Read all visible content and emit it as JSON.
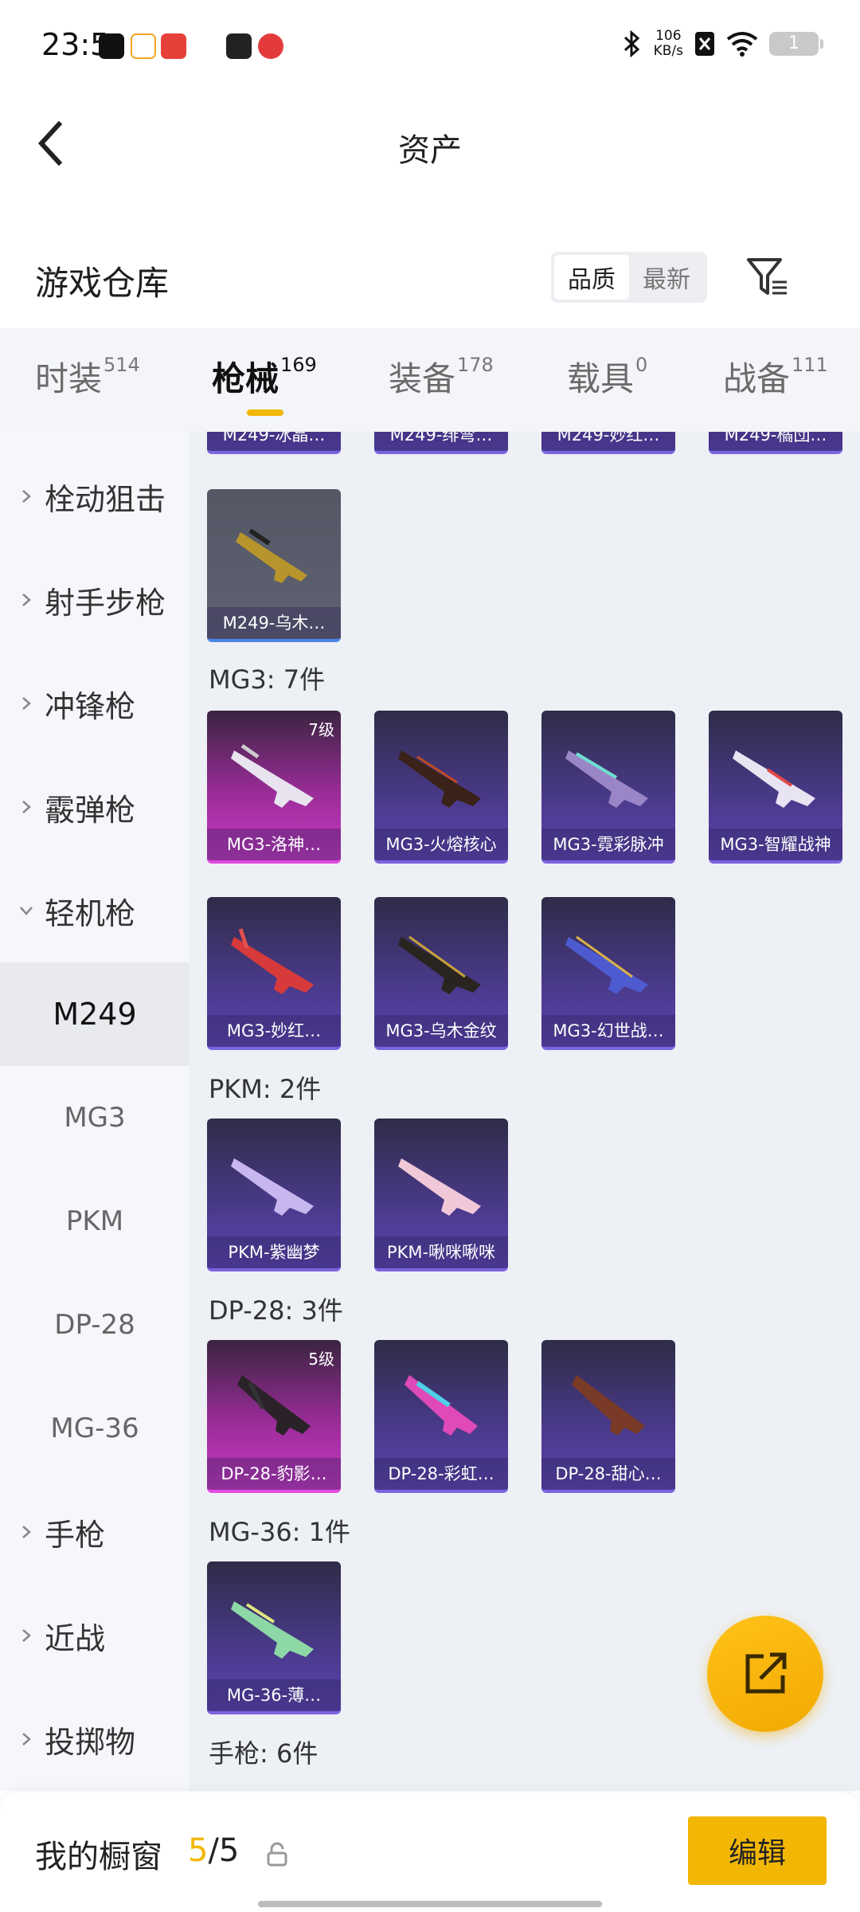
{
  "status_bar": {
    "time": "23:5",
    "net_speed_value": "106",
    "net_speed_unit": "KB/s",
    "battery": "1"
  },
  "header": {
    "title": "资产"
  },
  "warehouse": {
    "title": "游戏仓库",
    "sort_options": [
      "品质",
      "最新"
    ],
    "active_sort": "品质"
  },
  "tabs": [
    {
      "label": "时装",
      "count": "514"
    },
    {
      "label": "枪械",
      "count": "169"
    },
    {
      "label": "装备",
      "count": "178"
    },
    {
      "label": "载具",
      "count": "0"
    },
    {
      "label": "战备",
      "count": "111"
    }
  ],
  "active_tab": "枪械",
  "sidebar": {
    "categories": [
      "栓动狙击",
      "射手步枪",
      "冲锋枪",
      "霰弹枪",
      "轻机枪"
    ],
    "sub_items": [
      "M249",
      "MG3",
      "PKM",
      "DP-28",
      "MG-36"
    ],
    "active_sub": "M249",
    "more_categories": [
      "手枪",
      "近战",
      "投掷物"
    ]
  },
  "content": {
    "top_partial_cards": [
      "M249-冰晶…",
      "M249-绯弯…",
      "M249-妙红…",
      "M249-橘団…"
    ],
    "m249_last_card": "M249-乌木…",
    "groups": [
      {
        "title": "MG3: 7件",
        "cards": [
          {
            "name": "MG3-洛神…",
            "level": "7级",
            "tier": "pink"
          },
          {
            "name": "MG3-火熔核心",
            "tier": "purple"
          },
          {
            "name": "MG3-霓彩脉冲",
            "tier": "purple"
          },
          {
            "name": "MG3-智耀战神",
            "tier": "purple"
          },
          {
            "name": "MG3-妙红…",
            "tier": "purple"
          },
          {
            "name": "MG3-乌木金纹",
            "tier": "purple"
          },
          {
            "name": "MG3-幻世战…",
            "tier": "purple"
          }
        ]
      },
      {
        "title": "PKM: 2件",
        "cards": [
          {
            "name": "PKM-紫幽梦",
            "tier": "purple"
          },
          {
            "name": "PKM-啾咪啾咪",
            "tier": "purple"
          }
        ]
      },
      {
        "title": "DP-28: 3件",
        "cards": [
          {
            "name": "DP-28-豹影…",
            "level": "5级",
            "tier": "pink"
          },
          {
            "name": "DP-28-彩虹…",
            "tier": "purple"
          },
          {
            "name": "DP-28-甜心…",
            "tier": "purple"
          }
        ]
      },
      {
        "title": "MG-36: 1件",
        "cards": [
          {
            "name": "MG-36-薄…",
            "tier": "purple"
          }
        ]
      }
    ],
    "next_group_title": "手枪: 6件"
  },
  "bottom_bar": {
    "label": "我的橱窗",
    "current": "5",
    "total": "/5",
    "edit_label": "编辑"
  },
  "colors": {
    "accent": "#f2b705",
    "purple_card": "#4a3a8c",
    "pink_card": "#c93ac4"
  }
}
